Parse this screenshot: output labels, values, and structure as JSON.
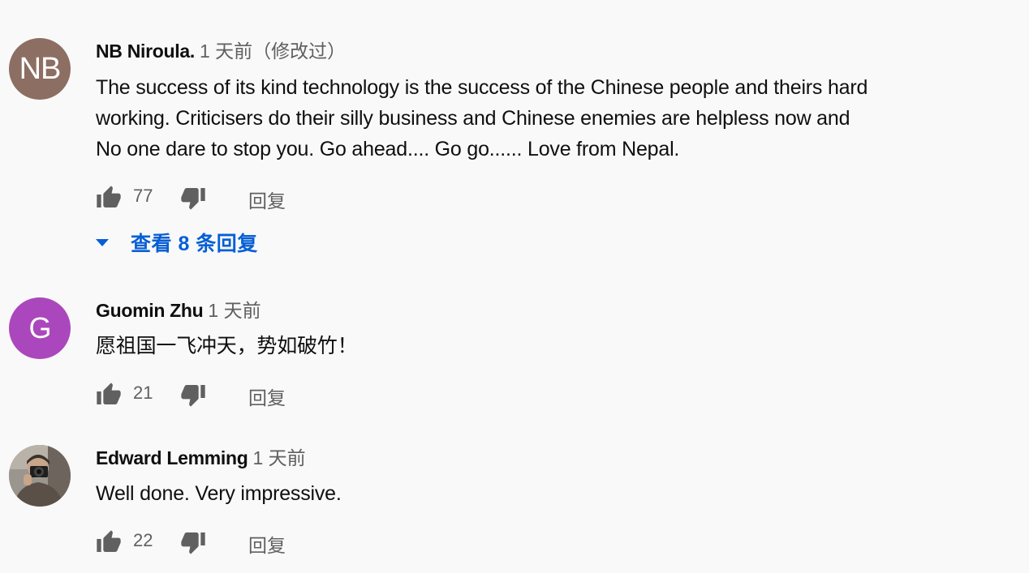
{
  "comments": [
    {
      "avatar_initials": "NB",
      "avatar_color": "#8d6e63",
      "author": "NB Niroula.",
      "meta": "1 天前（修改过）",
      "lines": [
        "The success of its kind technology is the success of the Chinese people and theirs hard",
        "working. Criticisers do their silly business and  Chinese enemies are helpless now and",
        "No one dare to stop you.  Go ahead.... Go go...... Love from Nepal."
      ],
      "likes": "77",
      "reply_label": "回复",
      "view_replies_label": "查看 8 条回复"
    },
    {
      "avatar_initials": "G",
      "avatar_color": "#ab47bc",
      "author": "Guomin Zhu",
      "meta": "1 天前",
      "lines": [
        "愿祖国一飞冲天，势如破竹！"
      ],
      "likes": "21",
      "reply_label": "回复"
    },
    {
      "avatar_icon": "photographer-photo",
      "author": "Edward Lemming",
      "meta": "1 天前",
      "lines": [
        "Well done. Very impressive."
      ],
      "likes": "22",
      "reply_label": "回复"
    }
  ],
  "icons": {
    "like": "thumbs-up-icon",
    "dislike": "thumbs-down-icon",
    "expand": "caret-down-icon"
  },
  "colors": {
    "link": "#065fd4",
    "secondary_text": "#606060",
    "icon": "#606060"
  }
}
